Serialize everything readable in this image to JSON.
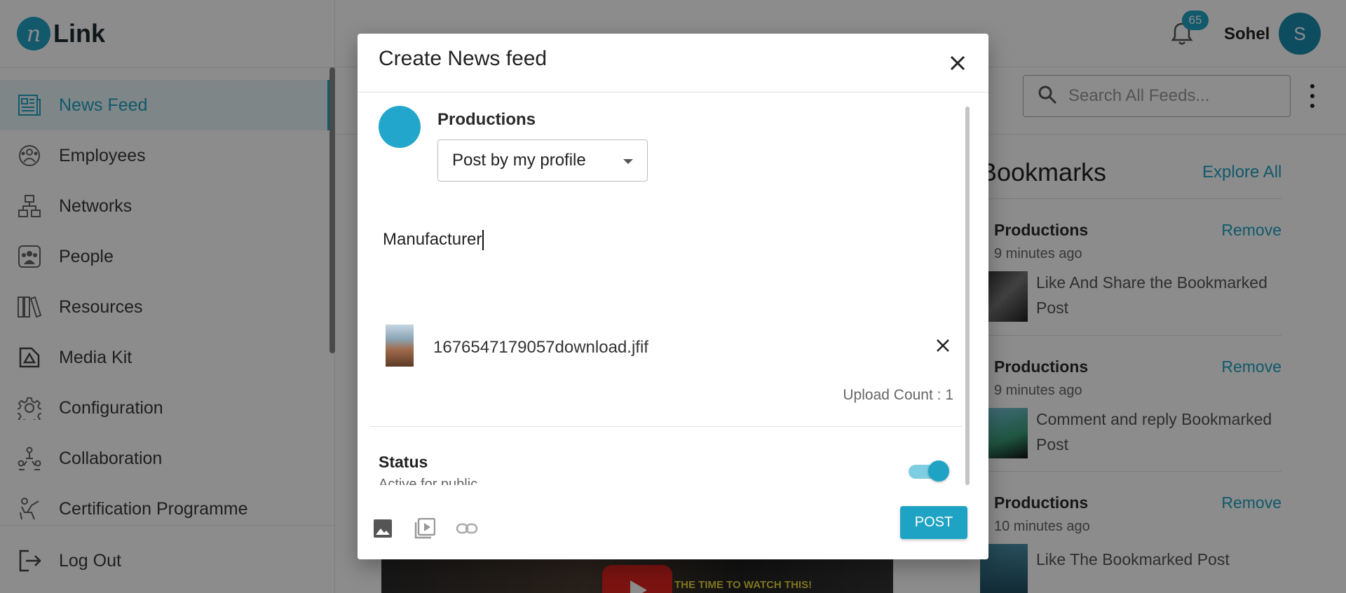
{
  "app": {
    "brand_name": "Link",
    "brand_mark": "n"
  },
  "sidebar": {
    "items": [
      {
        "label": "News Feed",
        "icon": "newspaper-icon",
        "active": true
      },
      {
        "label": "Employees",
        "icon": "employees-icon",
        "active": false
      },
      {
        "label": "Networks",
        "icon": "network-icon",
        "active": false
      },
      {
        "label": "People",
        "icon": "people-icon",
        "active": false
      },
      {
        "label": "Resources",
        "icon": "book-icon",
        "active": false
      },
      {
        "label": "Media Kit",
        "icon": "media-kit-icon",
        "active": false
      },
      {
        "label": "Configuration",
        "icon": "gear-icon",
        "active": false
      },
      {
        "label": "Collaboration",
        "icon": "collaboration-icon",
        "active": false
      },
      {
        "label": "Certification Programme",
        "icon": "certification-icon",
        "active": false
      }
    ],
    "logout_label": "Log Out"
  },
  "header": {
    "notification_count": "65",
    "user_name": "Sohel",
    "user_initial": "S"
  },
  "search": {
    "placeholder": "Search All Feeds..."
  },
  "bookmarks": {
    "title": "Bookmarks",
    "explore_label": "Explore All",
    "items": [
      {
        "author": "Productions",
        "time": "9 minutes ago",
        "text": "Like And Share the Bookmarked Post",
        "remove_label": "Remove"
      },
      {
        "author": "Productions",
        "time": "9 minutes ago",
        "text": "Comment and reply Bookmarked Post",
        "remove_label": "Remove"
      },
      {
        "author": "Productions",
        "time": "10 minutes ago",
        "text": "Like The Bookmarked Post",
        "remove_label": "Remove"
      }
    ]
  },
  "feed": {
    "video_caption": "THE TIME TO WATCH THIS!"
  },
  "modal": {
    "title": "Create News feed",
    "poster_name": "Productions",
    "post_as": "Post by my profile",
    "post_text": "Manufacturer",
    "attachment": {
      "file_name": "1676547179057download.jfif"
    },
    "upload_count": "Upload Count : 1",
    "status_title": "Status",
    "status_subtitle": "Active for public",
    "status_active": true,
    "post_button_label": "POST"
  },
  "colors": {
    "accent": "#1fa3c4",
    "overlay": "rgba(0,0,0,0.45)"
  }
}
